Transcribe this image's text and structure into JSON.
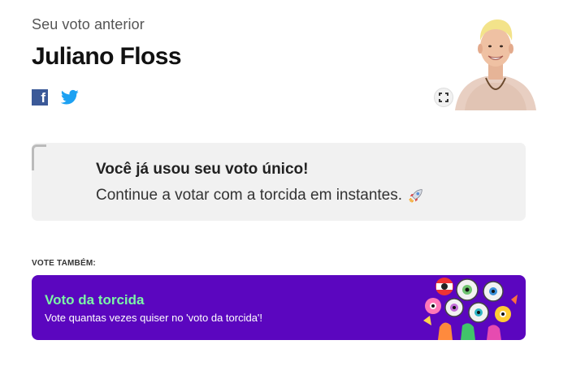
{
  "previous_vote": {
    "label": "Seu voto anterior",
    "name": "Juliano Floss"
  },
  "share": {
    "facebook_glyph": "f",
    "icons": [
      "facebook-icon",
      "twitter-icon"
    ]
  },
  "expand_icon": "expand-icon",
  "notice": {
    "title": "Você já usou seu voto único!",
    "text": "Continue a votar com a torcida em instantes.",
    "emoji": "rocket-icon"
  },
  "also_vote": {
    "label": "VOTE TAMBÉM:",
    "banner_title": "Voto da torcida",
    "banner_subtitle": "Vote quantas vezes quiser no 'voto da torcida'!"
  },
  "colors": {
    "banner_bg": "#5b06bf",
    "banner_title": "#7cf6a6",
    "facebook": "#3b5998",
    "twitter": "#1da1f2",
    "notice_bg": "#f1f1f1"
  }
}
